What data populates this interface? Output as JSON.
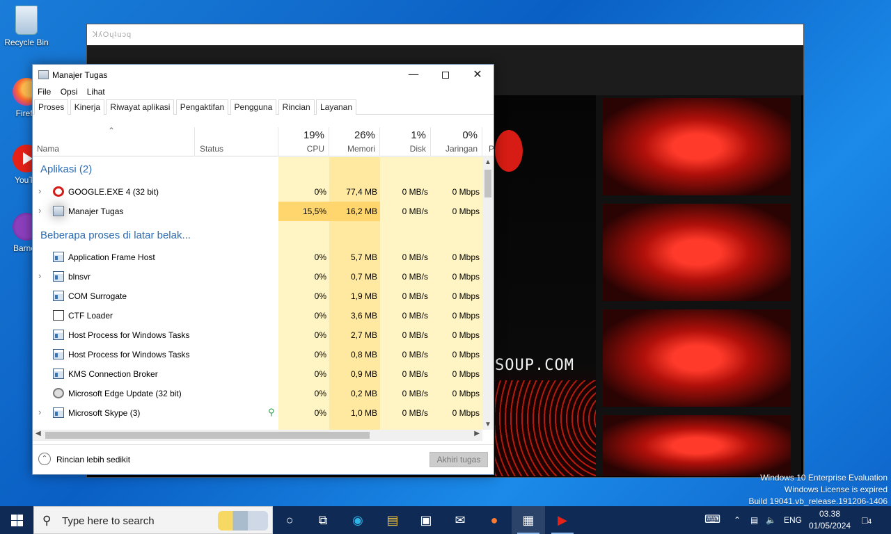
{
  "desktop": {
    "icons": [
      {
        "label": "Recycle Bin"
      },
      {
        "label": "Firefo"
      },
      {
        "label": "YouTu"
      },
      {
        "label": "Barney"
      }
    ]
  },
  "background_window": {
    "title": "ꓘʎOɥʇuɔq",
    "video_text": "SOUP.COM"
  },
  "task_manager": {
    "title": "Manajer Tugas",
    "menu": [
      "File",
      "Opsi",
      "Lihat"
    ],
    "tabs": [
      "Proses",
      "Kinerja",
      "Riwayat aplikasi",
      "Pengaktifan",
      "Pengguna",
      "Rincian",
      "Layanan"
    ],
    "active_tab": "Proses",
    "columns": {
      "name": "Nama",
      "status": "Status",
      "cpu": {
        "pct": "19%",
        "label": "CPU"
      },
      "memory": {
        "pct": "26%",
        "label": "Memori"
      },
      "disk": {
        "pct": "1%",
        "label": "Disk"
      },
      "network": {
        "pct": "0%",
        "label": "Jaringan"
      },
      "power": {
        "label": "P"
      }
    },
    "groups": [
      {
        "label": "Aplikasi (2)"
      },
      {
        "label": "Beberapa proses di latar belak..."
      }
    ],
    "rows": [
      {
        "name": "GOOGLE.EXE 4 (32 bit)",
        "cpu": "0%",
        "mem": "77,4 MB",
        "disk": "0 MB/s",
        "net": "0 Mbps"
      },
      {
        "name": "Manajer Tugas",
        "cpu": "15,5%",
        "mem": "16,2 MB",
        "disk": "0 MB/s",
        "net": "0 Mbps"
      },
      {
        "name": "Application Frame Host",
        "cpu": "0%",
        "mem": "5,7 MB",
        "disk": "0 MB/s",
        "net": "0 Mbps"
      },
      {
        "name": "blnsvr",
        "cpu": "0%",
        "mem": "0,7 MB",
        "disk": "0 MB/s",
        "net": "0 Mbps"
      },
      {
        "name": "COM Surrogate",
        "cpu": "0%",
        "mem": "1,9 MB",
        "disk": "0 MB/s",
        "net": "0 Mbps"
      },
      {
        "name": "CTF Loader",
        "cpu": "0%",
        "mem": "3,6 MB",
        "disk": "0 MB/s",
        "net": "0 Mbps"
      },
      {
        "name": "Host Process for Windows Tasks",
        "cpu": "0%",
        "mem": "2,7 MB",
        "disk": "0 MB/s",
        "net": "0 Mbps"
      },
      {
        "name": "Host Process for Windows Tasks",
        "cpu": "0%",
        "mem": "0,8 MB",
        "disk": "0 MB/s",
        "net": "0 Mbps"
      },
      {
        "name": "KMS Connection Broker",
        "cpu": "0%",
        "mem": "0,9 MB",
        "disk": "0 MB/s",
        "net": "0 Mbps"
      },
      {
        "name": "Microsoft Edge Update (32 bit)",
        "cpu": "0%",
        "mem": "0,2 MB",
        "disk": "0 MB/s",
        "net": "0 Mbps"
      },
      {
        "name": "Microsoft Skype (3)",
        "cpu": "0%",
        "mem": "1,0 MB",
        "disk": "0 MB/s",
        "net": "0 Mbps"
      }
    ],
    "footer": {
      "fewer_details": "Rincian lebih sedikit",
      "end_task": "Akhiri tugas"
    }
  },
  "watermark": {
    "line1": "Windows 10 Enterprise Evaluation",
    "line2": "Windows License is expired",
    "line3": "Build 19041.vb_release.191206-1406"
  },
  "taskbar": {
    "search_placeholder": "Type here to search",
    "language": "ENG",
    "time": "03.38",
    "date": "01/05/2024",
    "notification_count": "4"
  },
  "colors": {
    "heat_light": "#fff4c4",
    "heat_medium": "#ffe9a0",
    "group_blue": "#2a6ab3",
    "taskbar": "#0e2a55"
  }
}
